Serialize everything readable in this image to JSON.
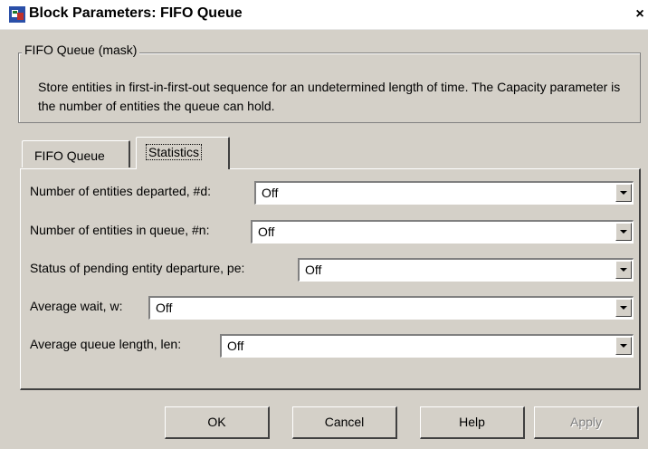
{
  "window": {
    "title": "Block Parameters: FIFO Queue",
    "close_symbol": "×"
  },
  "group": {
    "title": "FIFO Queue (mask)",
    "description": "Store entities in first-in-first-out sequence for an undetermined length of time. The Capacity parameter is the number of entities the queue can hold."
  },
  "tabs": [
    {
      "label": "FIFO Queue",
      "active": false
    },
    {
      "label": "Statistics",
      "active": true
    }
  ],
  "params": [
    {
      "label": "Number of entities departed, #d:",
      "value": "Off"
    },
    {
      "label": "Number of entities in queue, #n:",
      "value": "Off"
    },
    {
      "label": "Status of pending entity departure, pe:",
      "value": "Off"
    },
    {
      "label": "Average wait, w:",
      "value": "Off"
    },
    {
      "label": "Average queue length, len:",
      "value": "Off"
    }
  ],
  "buttons": {
    "ok": "OK",
    "cancel": "Cancel",
    "help": "Help",
    "apply": "Apply"
  },
  "colors": {
    "dialog_bg": "#d4d0c8",
    "title_bar_bg": "#ffffff",
    "disabled_text": "#808080"
  }
}
